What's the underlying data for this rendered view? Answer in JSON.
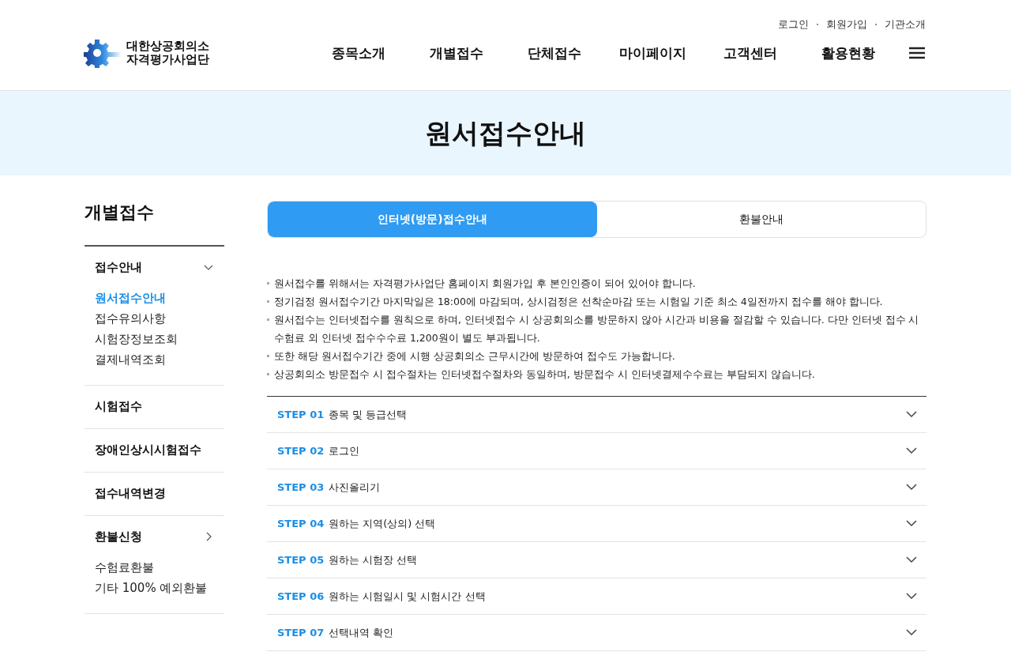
{
  "logo": {
    "line1": "대한상공회의소",
    "line2": "자격평가사업단"
  },
  "util_links": [
    "로그인",
    "회원가입",
    "기관소개"
  ],
  "nav": [
    "종목소개",
    "개별접수",
    "단체접수",
    "마이페이지",
    "고객센터",
    "활용현황"
  ],
  "page_title": "원서접수안내",
  "sidebar": {
    "title": "개별접수",
    "groups": [
      {
        "label": "접수안내",
        "expanded": true,
        "children": [
          {
            "label": "원서접수안내",
            "selected": true
          },
          {
            "label": "접수유의사항",
            "selected": false
          },
          {
            "label": "시험장정보조회",
            "selected": false
          },
          {
            "label": "결제내역조회",
            "selected": false
          }
        ]
      },
      {
        "label": "시험접수"
      },
      {
        "label": "장애인상시시험접수"
      },
      {
        "label": "접수내역변경"
      },
      {
        "label": "환불신청",
        "expanded": false,
        "children": [
          {
            "label": "수험료환불",
            "selected": false
          },
          {
            "label": "기타 100% 예외환불",
            "selected": false
          }
        ]
      }
    ]
  },
  "tabs": [
    {
      "label": "인터넷(방문)접수안내",
      "selected": true
    },
    {
      "label": "환불안내",
      "selected": false
    }
  ],
  "notices": [
    "원서접수를 위해서는 자격평가사업단 홈페이지 회원가입 후 본인인증이 되어 있어야 합니다.",
    "정기검정 원서접수기간 마지막일은 18:00에 마감되며, 상시검정은 선착순마감 또는 시험일 기준 최소 4일전까지 접수를 해야 합니다.",
    "원서접수는 인터넷접수를 원칙으로 하며, 인터넷접수 시 상공회의소를 방문하지 않아 시간과 비용을 절감할 수 있습니다. 다만 인터넷 접수 시 수험료 외 인터넷 접수수수료 1,200원이 별도 부과됩니다.",
    "또한 해당 원서접수기간 중에 시행 상공회의소 근무시간에 방문하여 접수도 가능합니다.",
    "상공회의소 방문접수 시 접수절차는 인터넷접수절차와 동일하며, 방문접수 시 인터넷결제수수료는 부담되지 않습니다."
  ],
  "steps": [
    {
      "step": "STEP 01",
      "title": "종목 및 등급선택",
      "expanded": false
    },
    {
      "step": "STEP 02",
      "title": "로그인",
      "expanded": false
    },
    {
      "step": "STEP 03",
      "title": "사진올리기",
      "expanded": false
    },
    {
      "step": "STEP 04",
      "title": "원하는 지역(상의) 선택",
      "expanded": false
    },
    {
      "step": "STEP 05",
      "title": "원하는 시험장 선택",
      "expanded": false
    },
    {
      "step": "STEP 06",
      "title": "원하는 시험일시 및 시험시간 선택",
      "expanded": false
    },
    {
      "step": "STEP 07",
      "title": "선택내역 확인",
      "expanded": false
    }
  ]
}
